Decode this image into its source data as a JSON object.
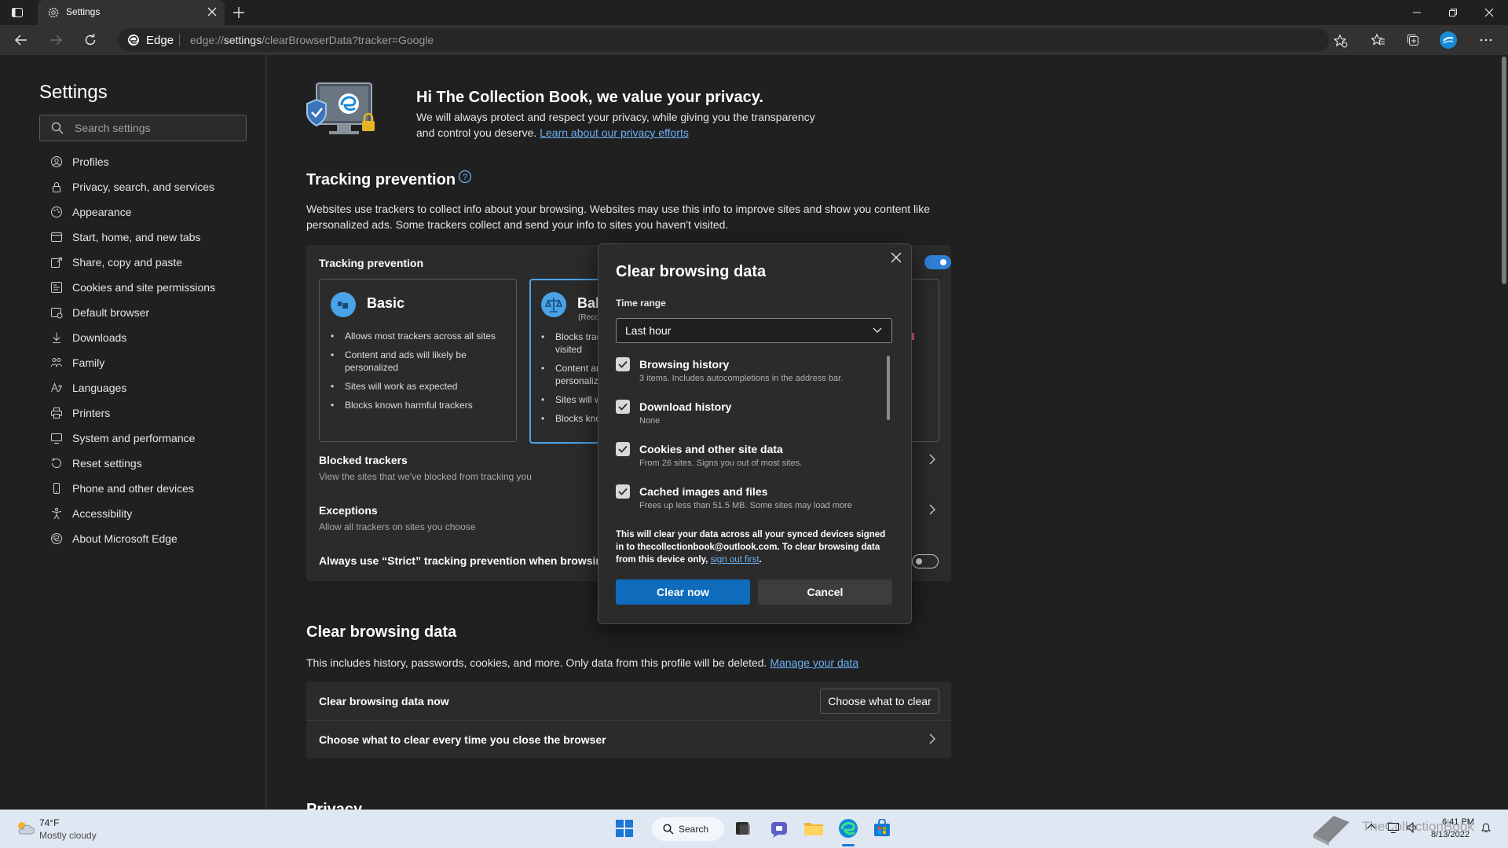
{
  "browser": {
    "tab_title": "Settings",
    "edge_label": "Edge",
    "url_prefix": "edge://",
    "url_bold": "settings",
    "url_rest": "/clearBrowserData?tracker=Google"
  },
  "sidebar": {
    "title": "Settings",
    "search_placeholder": "Search settings",
    "items": [
      {
        "label": "Profiles",
        "icon": "profile-icon"
      },
      {
        "label": "Privacy, search, and services",
        "icon": "lock-icon"
      },
      {
        "label": "Appearance",
        "icon": "appearance-icon"
      },
      {
        "label": "Start, home, and new tabs",
        "icon": "home-icon"
      },
      {
        "label": "Share, copy and paste",
        "icon": "share-icon"
      },
      {
        "label": "Cookies and site permissions",
        "icon": "cookies-icon"
      },
      {
        "label": "Default browser",
        "icon": "browser-icon"
      },
      {
        "label": "Downloads",
        "icon": "download-icon"
      },
      {
        "label": "Family",
        "icon": "family-icon"
      },
      {
        "label": "Languages",
        "icon": "language-icon"
      },
      {
        "label": "Printers",
        "icon": "printer-icon"
      },
      {
        "label": "System and performance",
        "icon": "system-icon"
      },
      {
        "label": "Reset settings",
        "icon": "reset-icon"
      },
      {
        "label": "Phone and other devices",
        "icon": "phone-icon"
      },
      {
        "label": "Accessibility",
        "icon": "accessibility-icon"
      },
      {
        "label": "About Microsoft Edge",
        "icon": "edge-icon"
      }
    ]
  },
  "privacy_banner": {
    "title": "Hi The Collection Book, we value your privacy.",
    "body": "We will always protect and respect your privacy, while giving you the transparency",
    "body2": "and control you deserve.",
    "link": "Learn about our privacy efforts"
  },
  "tracking": {
    "heading": "Tracking prevention",
    "desc1": "Websites use trackers to collect info about your browsing. Websites may use this info to improve sites and show you content like",
    "desc2": "personalized ads. Some trackers collect and send your info to sites you haven't visited.",
    "card_title": "Tracking prevention",
    "basic": {
      "title": "Basic",
      "bullets": [
        "Allows most trackers across all sites",
        "Content and ads will likely be personalized",
        "Sites will work as expected",
        "Blocks known harmful trackers"
      ]
    },
    "balanced": {
      "title": "Bal",
      "sub": "(Reco",
      "bullets": [
        "Blocks trac",
        "visited",
        "Content an",
        "personaliz",
        "Sites will w",
        "Blocks kno"
      ]
    },
    "blocked_title": "Blocked trackers",
    "blocked_sub": "View the sites that we've blocked from tracking you",
    "exceptions_title": "Exceptions",
    "exceptions_sub": "Allow all trackers on sites you choose",
    "strict_label": "Always use “Strict” tracking prevention when browsing I"
  },
  "clear_section": {
    "heading": "Clear browsing data",
    "desc": "This includes history, passwords, cookies, and more. Only data from this profile will be deleted.",
    "manage_link": "Manage your data",
    "row1": "Clear browsing data now",
    "row1_button": "Choose what to clear",
    "row2": "Choose what to clear every time you close the browser",
    "next_heading": "Privacy"
  },
  "dialog": {
    "title": "Clear browsing data",
    "time_range_label": "Time range",
    "time_range_value": "Last hour",
    "items": [
      {
        "title": "Browsing history",
        "sub": "3 items. Includes autocompletions in the address bar.",
        "checked": true
      },
      {
        "title": "Download history",
        "sub": "None",
        "checked": true
      },
      {
        "title": "Cookies and other site data",
        "sub": "From 26 sites. Signs you out of most sites.",
        "checked": true
      },
      {
        "title": "Cached images and files",
        "sub": "Frees up less than 51.5 MB. Some sites may load more",
        "checked": true
      }
    ],
    "note": "This will clear your data across all your synced devices signed in to thecollectionbook@outlook.com. To clear browsing data from this device only,",
    "note_link": "sign out first",
    "note_end": ".",
    "clear_button": "Clear now",
    "cancel_button": "Cancel"
  },
  "taskbar": {
    "weather_temp": "74°F",
    "weather_desc": "Mostly cloudy",
    "search_label": "Search",
    "time": "6:41 PM",
    "date": "8/13/2022",
    "watermark": "TheCollectionBook"
  },
  "colors": {
    "accent": "#0f6cbd",
    "link": "#6ab0f3",
    "background": "#202020",
    "card": "#2b2b2b"
  }
}
